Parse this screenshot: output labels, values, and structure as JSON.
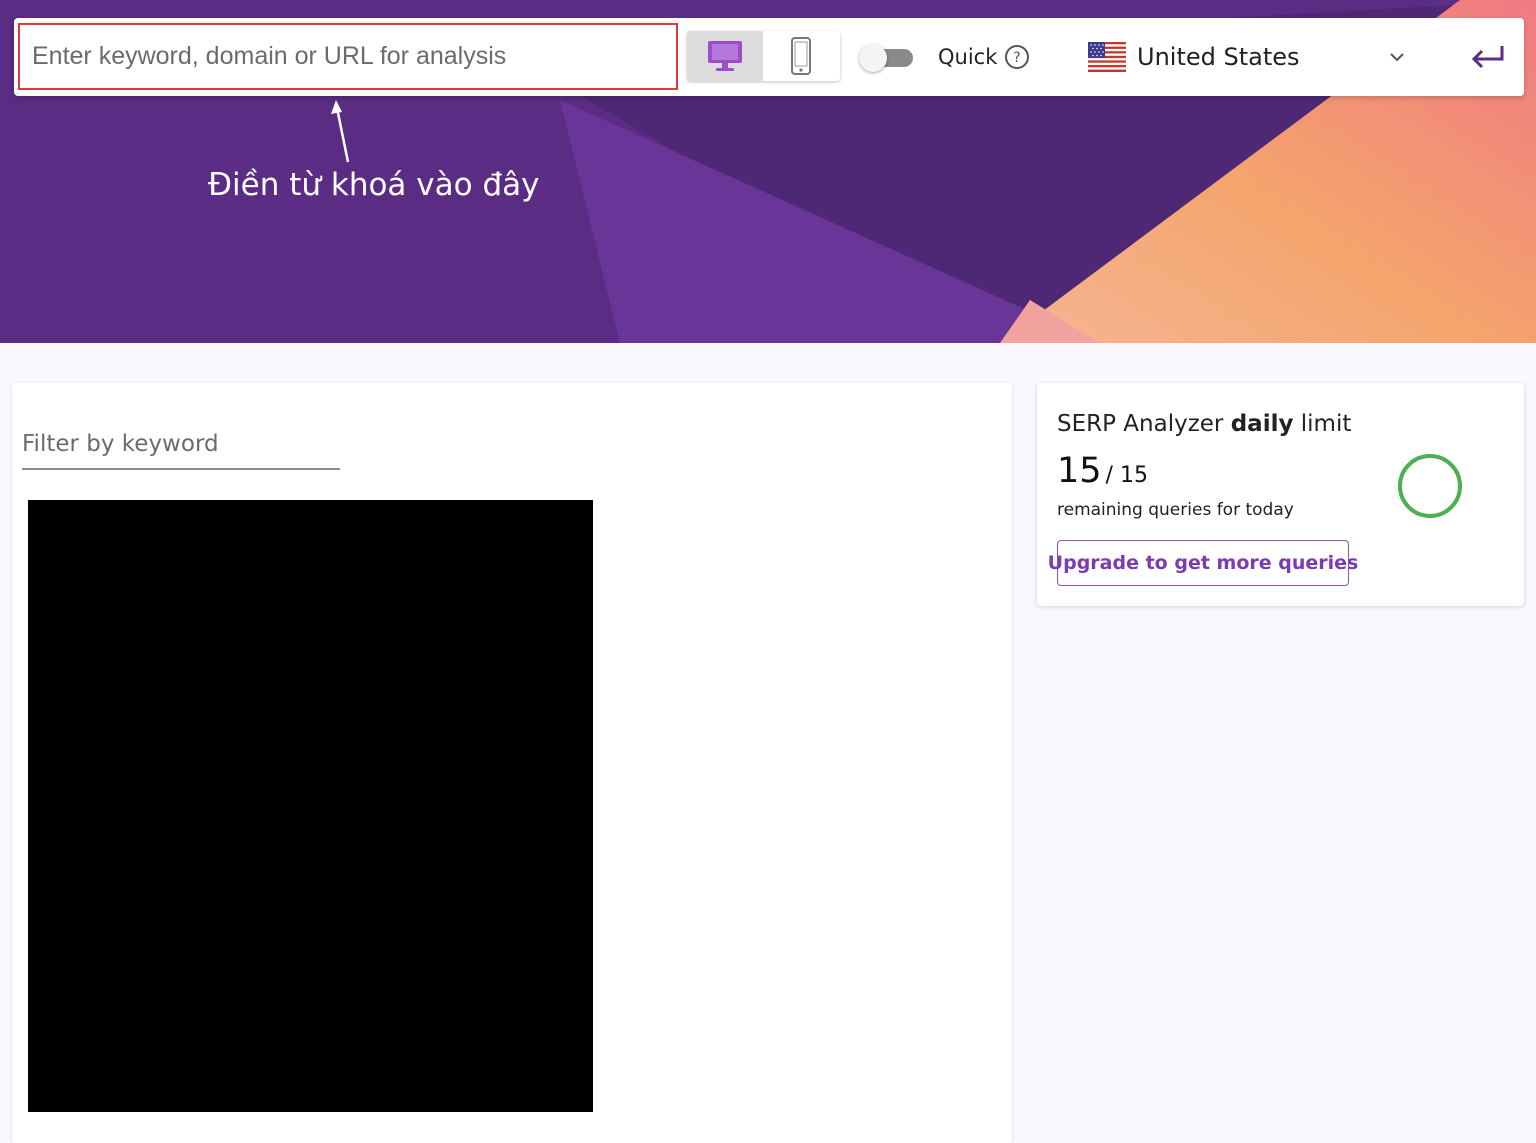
{
  "search": {
    "placeholder": "Enter keyword, domain or URL for analysis"
  },
  "device_toggle": {
    "selected": "desktop",
    "options": [
      "desktop-icon",
      "mobile-icon"
    ]
  },
  "quick": {
    "label": "Quick",
    "enabled": false
  },
  "country": {
    "name": "United States",
    "flag": "us-flag-icon"
  },
  "annotation": {
    "text": "Điền từ khoá vào đây"
  },
  "results": {
    "filter_placeholder": "Filter by keyword"
  },
  "limit_card": {
    "title_prefix": "SERP Analyzer ",
    "title_bold": "daily",
    "title_suffix": " limit",
    "remaining": "15",
    "total": "/ 15",
    "subtitle": "remaining queries for today",
    "upgrade_label": "Upgrade to get more queries",
    "remaining_fraction": 1.0
  },
  "colors": {
    "brand_purple": "#5b2e86",
    "accent_orange": "#f4a56c",
    "accent_pink": "#f07a82",
    "ring_green": "#4caf50",
    "search_outline_red": "#e53935",
    "device_active_purple": "#9b4dca"
  }
}
